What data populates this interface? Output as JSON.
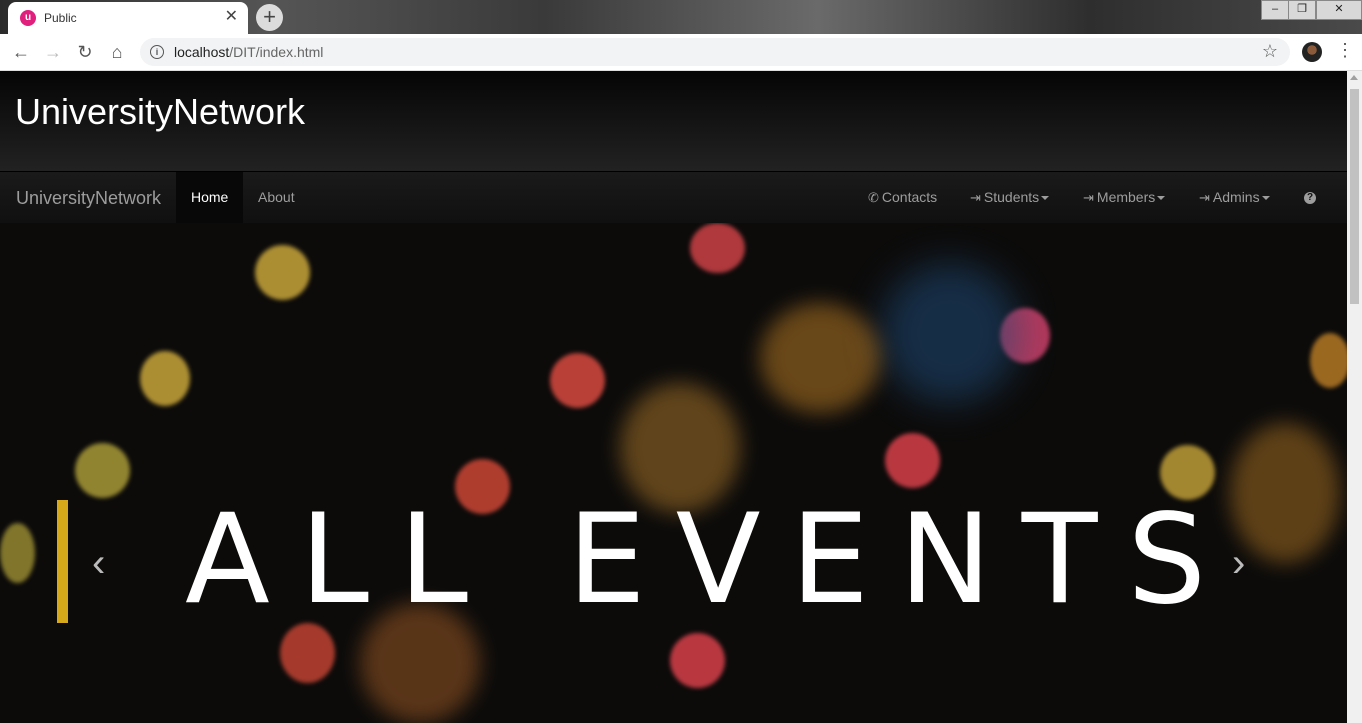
{
  "browser": {
    "tab_title": "Public",
    "tab_favicon": "u",
    "url_host": "localhost",
    "url_path": "/DIT/index.html"
  },
  "page": {
    "header_title": "UniversityNetwork",
    "navbar": {
      "brand": "UniversityNetwork",
      "left_items": [
        {
          "label": "Home",
          "active": true
        },
        {
          "label": "About",
          "active": false
        }
      ],
      "right_items": [
        {
          "label": "Contacts",
          "icon": "phone-icon",
          "dropdown": false
        },
        {
          "label": "Students",
          "icon": "log-in-icon",
          "dropdown": true
        },
        {
          "label": "Members",
          "icon": "log-in-icon",
          "dropdown": true
        },
        {
          "label": "Admins",
          "icon": "log-in-icon",
          "dropdown": true
        },
        {
          "label": "",
          "icon": "question-sign-icon",
          "dropdown": false
        }
      ]
    },
    "carousel": {
      "slide_text": "ALL EVENTS",
      "accent_color": "#d6a91a"
    }
  }
}
